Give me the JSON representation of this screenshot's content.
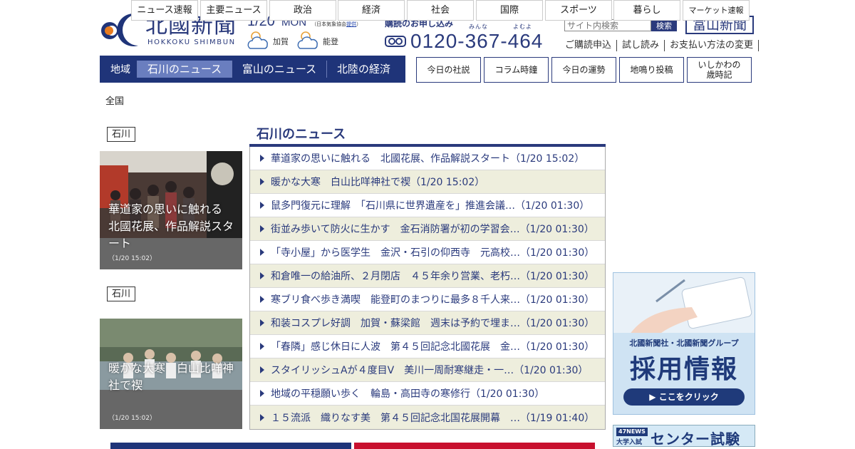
{
  "header": {
    "logo_name": "北國新聞",
    "logo_roman": "HOKKOKU SHIMBUN",
    "date": "1/20",
    "weekday": "MON",
    "weather_source_prefix": "（日本気象協会",
    "weather_source_link": "提供",
    "weather_source_suffix": "）",
    "weather": [
      {
        "area": "加賀",
        "icon": "cloudy-sun-icon"
      },
      {
        "area": "能登",
        "icon": "cloudy-sun-icon"
      }
    ]
  },
  "subscribe": {
    "heading": "購読のお申し込み",
    "ruby_1": "みんな",
    "ruby_2": "よむよ",
    "phone": "0120-367-464"
  },
  "search": {
    "placeholder": "サイト内検索",
    "button": "検索"
  },
  "toyama_link": "富山新聞",
  "sublinks": [
    "ご購読申込",
    "試し読み",
    "お支払い方法の変更"
  ],
  "region": {
    "label": "地域",
    "tabs": [
      "石川のニュース",
      "富山のニュース",
      "北陸の経済"
    ],
    "active_tab": 0
  },
  "features": [
    "今日の社説",
    "コラム時鐘",
    "今日の運勢",
    "地鳴り投稿",
    "いしかわの\n歳時記"
  ],
  "categories": {
    "all_label": "全国",
    "items": [
      "ニュース速報",
      "主要ニュース",
      "政治",
      "経済",
      "社会",
      "国際",
      "スポーツ",
      "暮らし",
      "マーケット速報"
    ]
  },
  "photo_cards": [
    {
      "pref": "石川",
      "caption": "華道家の思いに触れる　北國花展、作品解説スタート",
      "time": "（1/20 15:02）"
    },
    {
      "pref": "石川",
      "caption": "暖かな大寒　白山比咩神社で禊",
      "time": "（1/20 15:02）"
    }
  ],
  "news_section": {
    "title": "石川のニュース",
    "items": [
      "華道家の思いに触れる　北國花展、作品解説スタート（1/20 15:02）",
      "暖かな大寒　白山比咩神社で禊（1/20 15:02）",
      "鼠多門復元に理解　「石川県に世界遺産を」推進会議…（1/20 01:30）",
      "街並み歩いて防火に生かす　金石消防署が初の学習会…（1/20 01:30）",
      "「寺小屋」から医学生　金沢・石引の仰西寺　元高校…（1/20 01:30）",
      "和倉唯一の給油所、２月閉店　４５年余り営業、老朽…（1/20 01:30）",
      "寒ブリ食べ歩き満喫　能登町のまつりに最多８千人来…（1/20 01:30）",
      "和装コスプレ好調　加賀・蘇梁館　週末は予約で埋ま…（1/20 01:30）",
      "「春隣」感じ休日に人波　第４５回記念北國花展　金…（1/20 01:30）",
      "スタイリッシュAが４度目V　美川一周耐寒継走・一…（1/20 01:30）",
      "地域の平穏願い歩く　輪島・高田寺の寒修行（1/20 01:30）",
      "１５流派　織りなす美　第４５回記念北国花展開幕　…（1/19 01:40）"
    ]
  },
  "ads": {
    "recruit_company": "北國新聞社・北國新聞グループ",
    "recruit_title": "採用情報",
    "recruit_button": "▶ ここをクリック",
    "exam_tag": "47NEWS",
    "exam_tag2": "大学入試",
    "exam_text": "センター試験特集"
  },
  "colors": {
    "brand_navy": "#2a3a7c",
    "active_tab": "#6a7ebf",
    "stripe": "#eeeedd"
  }
}
